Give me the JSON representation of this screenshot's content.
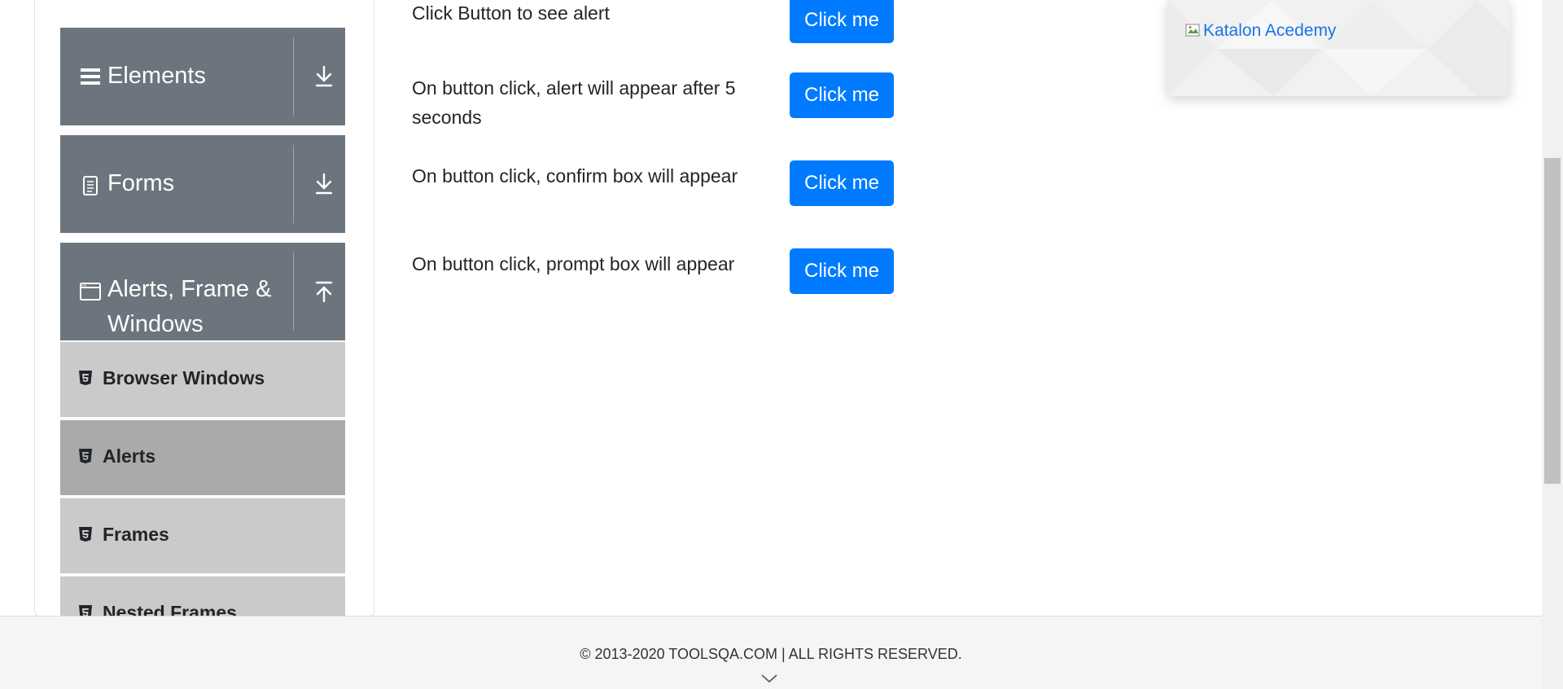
{
  "sidebar": {
    "groups": [
      {
        "title": "Elements",
        "icon": "hamburger-icon",
        "arrow": "download-arrow-icon"
      },
      {
        "title": "Forms",
        "icon": "document-icon",
        "arrow": "download-arrow-icon"
      },
      {
        "title_line1": "Alerts, Frame &",
        "title_line2": "Windows",
        "icon": "window-icon",
        "arrow": "upload-arrow-icon"
      }
    ],
    "items": [
      {
        "label": "Browser Windows",
        "active": false
      },
      {
        "label": "Alerts",
        "active": true
      },
      {
        "label": "Frames",
        "active": false
      },
      {
        "label": "Nested Frames",
        "active": false
      }
    ]
  },
  "alerts": [
    {
      "text": "Click Button to see alert",
      "button": "Click me"
    },
    {
      "text": "On button click, alert will appear after 5 seconds",
      "button": "Click me"
    },
    {
      "text": "On button click, confirm box will appear",
      "button": "Click me"
    },
    {
      "text": "On button click, prompt box will appear",
      "button": "Click me"
    }
  ],
  "ad": {
    "alt_text": "Katalon Acedemy"
  },
  "footer": {
    "copyright": "© 2013-2020 TOOLSQA.COM | ALL RIGHTS RESERVED."
  },
  "colors": {
    "accent": "#007bff",
    "group_bg": "#6c757d",
    "item_bg": "#cacaca",
    "item_active_bg": "#aaaaaa"
  }
}
